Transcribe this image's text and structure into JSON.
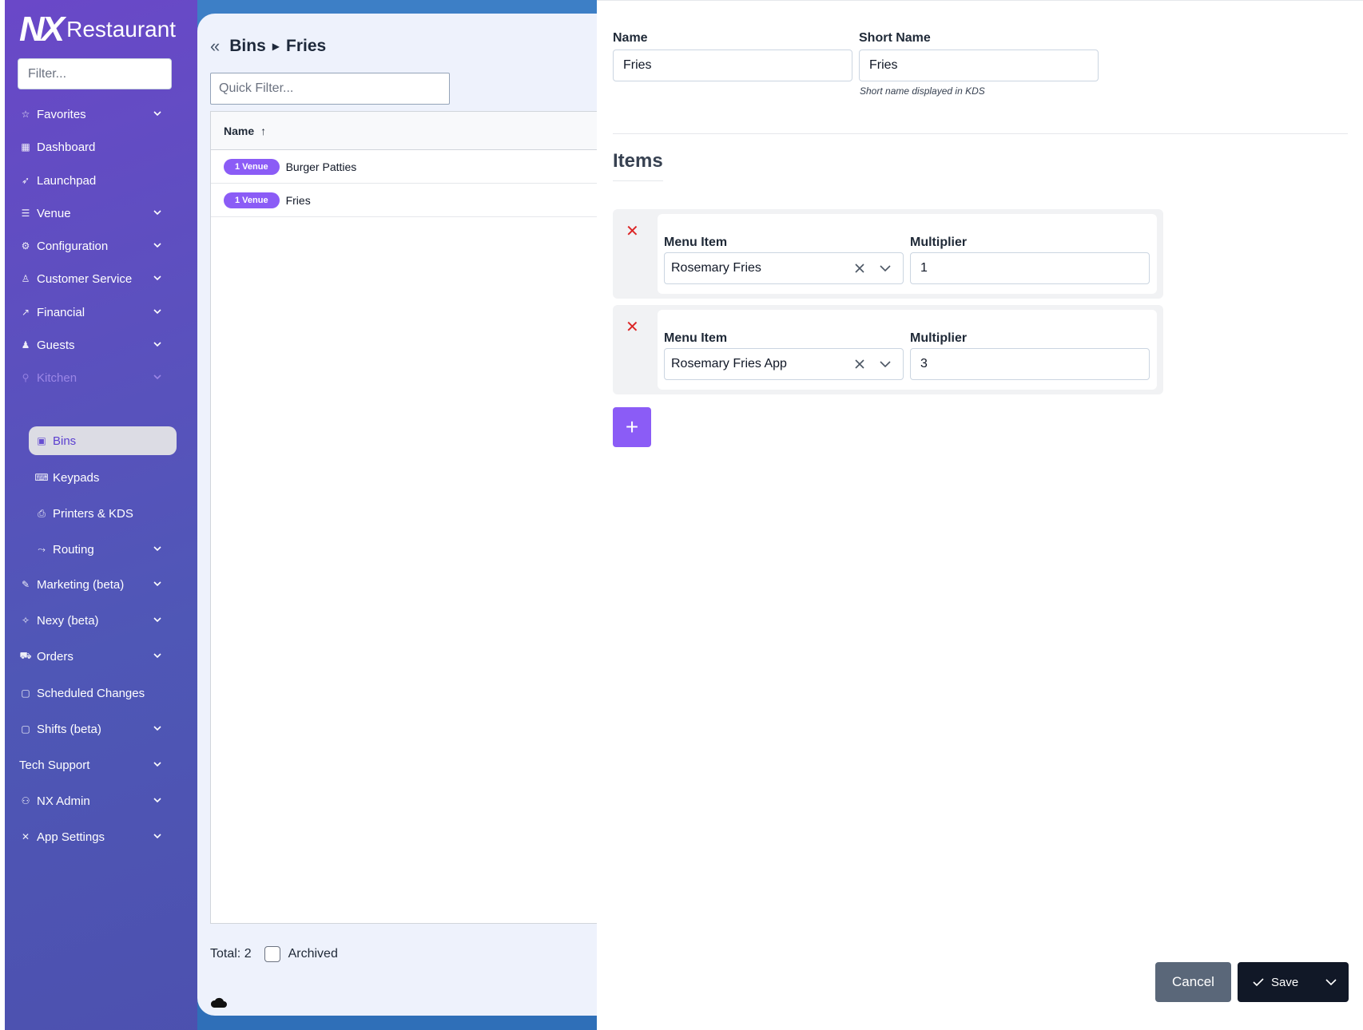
{
  "app": {
    "logo_mark": "NX",
    "logo_text": "Restaurant"
  },
  "sidebar": {
    "filter_placeholder": "Filter...",
    "items": [
      {
        "label": "Favorites",
        "icon": "star-icon",
        "expandable": true
      },
      {
        "label": "Dashboard",
        "icon": "dashboard-icon",
        "expandable": false
      },
      {
        "label": "Launchpad",
        "icon": "rocket-icon",
        "expandable": false
      },
      {
        "label": "Venue",
        "icon": "venue-icon",
        "expandable": true
      },
      {
        "label": "Configuration",
        "icon": "gear-icon",
        "expandable": true
      },
      {
        "label": "Customer Service",
        "icon": "person-icon",
        "expandable": true
      },
      {
        "label": "Financial",
        "icon": "chart-icon",
        "expandable": true
      },
      {
        "label": "Guests",
        "icon": "guests-icon",
        "expandable": true
      },
      {
        "label": "Kitchen",
        "icon": "kitchen-icon",
        "expandable": true
      },
      {
        "label": "Marketing (beta)",
        "icon": "megaphone-icon",
        "expandable": true
      },
      {
        "label": "Nexy (beta)",
        "icon": "sparkle-icon",
        "expandable": true
      },
      {
        "label": "Orders",
        "icon": "cart-icon",
        "expandable": true
      },
      {
        "label": "Scheduled Changes",
        "icon": "calendar-icon",
        "expandable": false
      },
      {
        "label": "Shifts (beta)",
        "icon": "calendar-icon",
        "expandable": true
      },
      {
        "label": "Tech Support",
        "icon": "",
        "expandable": true
      },
      {
        "label": "NX Admin",
        "icon": "admin-icon",
        "expandable": true
      },
      {
        "label": "App Settings",
        "icon": "tools-icon",
        "expandable": true
      }
    ],
    "kitchen_sub": [
      {
        "label": "Bins",
        "icon": "bin-icon",
        "active": true
      },
      {
        "label": "Keypads",
        "icon": "keyboard-icon"
      },
      {
        "label": "Printers & KDS",
        "icon": "printer-icon"
      },
      {
        "label": "Routing",
        "icon": "routing-icon",
        "expandable": true
      }
    ]
  },
  "main": {
    "breadcrumb": {
      "parent": "Bins",
      "current": "Fries"
    },
    "quick_filter_placeholder": "Quick Filter...",
    "grid": {
      "column": "Name",
      "rows": [
        {
          "badge": "1 Venue",
          "name": "Burger Patties"
        },
        {
          "badge": "1 Venue",
          "name": "Fries"
        }
      ]
    },
    "footer": {
      "total": "Total: 2",
      "archived_label": "Archived"
    }
  },
  "editor": {
    "name_label": "Name",
    "name_value": "Fries",
    "short_name_label": "Short Name",
    "short_name_value": "Fries",
    "short_name_hint": "Short name displayed in KDS",
    "items_title": "Items",
    "items": [
      {
        "menu_item_label": "Menu Item",
        "menu_item": "Rosemary Fries",
        "multiplier_label": "Multiplier",
        "multiplier": "1"
      },
      {
        "menu_item_label": "Menu Item",
        "menu_item": "Rosemary Fries App",
        "multiplier_label": "Multiplier",
        "multiplier": "3"
      }
    ],
    "add_label": "+",
    "cancel_label": "Cancel",
    "save_label": "Save"
  },
  "colors": {
    "accent": "#8b5cf6",
    "danger": "#dc2626",
    "dark": "#111827",
    "cancel": "#5a6779"
  }
}
